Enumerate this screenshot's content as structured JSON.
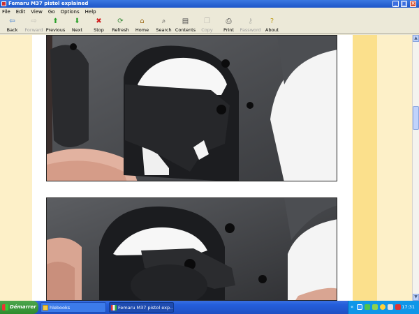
{
  "window": {
    "title": "Femaru M37 pistol explained"
  },
  "menu": [
    "File",
    "Edit",
    "View",
    "Go",
    "Options",
    "Help"
  ],
  "toolbar": [
    {
      "label": "Back",
      "icon": "back-arrow-icon",
      "glyph": "⇦",
      "color": "#2a70d0",
      "enabled": true
    },
    {
      "label": "Forward",
      "icon": "forward-arrow-icon",
      "glyph": "⇨",
      "color": "#888888",
      "enabled": false
    },
    {
      "label": "Previous",
      "icon": "previous-arrow-icon",
      "glyph": "⬆",
      "color": "#2aa02a",
      "enabled": true
    },
    {
      "label": "Next",
      "icon": "next-arrow-icon",
      "glyph": "⬇",
      "color": "#2aa02a",
      "enabled": true
    },
    {
      "label": "Stop",
      "icon": "stop-icon",
      "glyph": "✖",
      "color": "#d02020",
      "enabled": true
    },
    {
      "label": "Refresh",
      "icon": "refresh-icon",
      "glyph": "⟳",
      "color": "#3a8a3a",
      "enabled": true
    },
    {
      "label": "Home",
      "icon": "home-icon",
      "glyph": "⌂",
      "color": "#a07020",
      "enabled": true
    },
    {
      "label": "Search",
      "icon": "search-icon",
      "glyph": "⌕",
      "color": "#404040",
      "enabled": true
    },
    {
      "label": "Contents",
      "icon": "contents-icon",
      "glyph": "▤",
      "color": "#505050",
      "enabled": true
    },
    {
      "label": "Copy",
      "icon": "copy-icon",
      "glyph": "❐",
      "color": "#888888",
      "enabled": false
    },
    {
      "label": "Print",
      "icon": "print-icon",
      "glyph": "⎙",
      "color": "#404040",
      "enabled": true
    },
    {
      "label": "Password",
      "icon": "key-icon",
      "glyph": "⚷",
      "color": "#888888",
      "enabled": false
    },
    {
      "label": "About",
      "icon": "about-icon",
      "glyph": "?",
      "color": "#c0a020",
      "enabled": true
    }
  ],
  "taskbar": {
    "start_label": "Démarrer",
    "tasks": [
      {
        "label": "hlebooks",
        "icon": "folder-icon"
      },
      {
        "label": "Femaru M37 pistol exp...",
        "icon": "book-icon"
      }
    ],
    "tray_chevron": "«",
    "clock": "17:31"
  },
  "colors": {
    "page_margin": "#fdf0c8",
    "page_band": "#fbe08c",
    "title_bar": "#1d55c9"
  }
}
